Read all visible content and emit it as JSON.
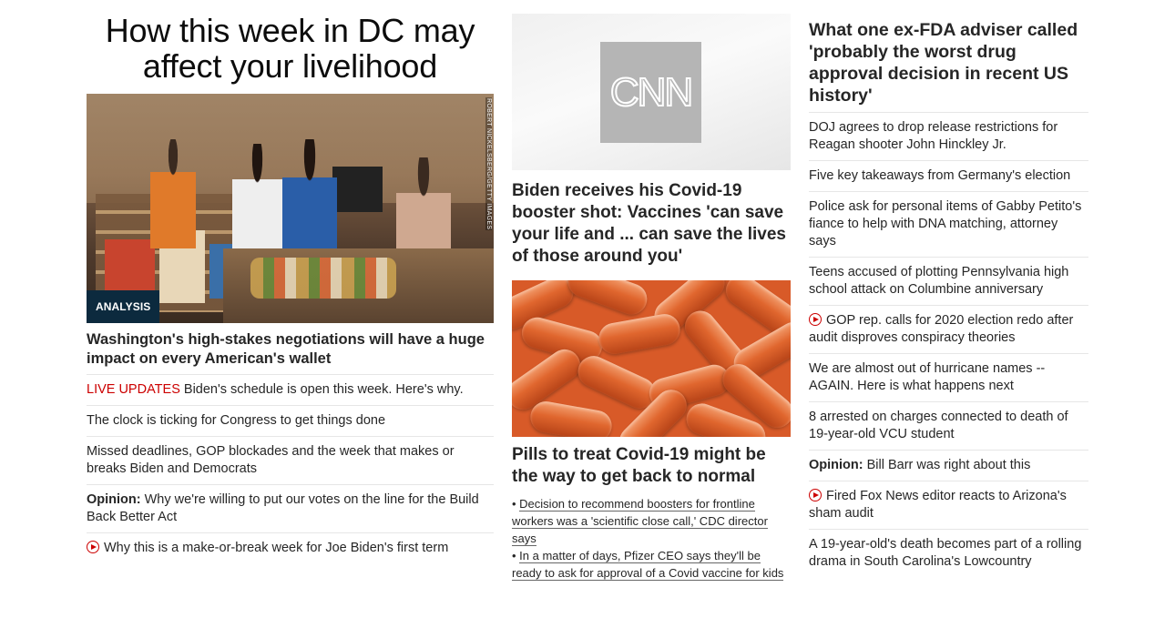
{
  "left": {
    "headline": "How this week in DC may affect your livelihood",
    "hero_credit": "ROBERT NICKELSBERG/GETTY IMAGES",
    "hero_badge": "ANALYSIS",
    "lead_title": "Washington's high-stakes negotiations will have a huge impact on every American's wallet",
    "items": [
      {
        "prefix": "LIVE UPDATES",
        "text": "Biden's schedule is open this week. Here's why."
      },
      {
        "text": "The clock is ticking for Congress to get things done"
      },
      {
        "text": "Missed deadlines, GOP blockades and the week that makes or breaks Biden and Democrats"
      },
      {
        "prefix": "Opinion:",
        "text": "Why we're willing to put our votes on the line for the Build Back Better Act"
      },
      {
        "video": true,
        "text": "Why this is a make-or-break week for Joe Biden's first term"
      }
    ]
  },
  "middle": {
    "logo_text": "CNN",
    "title1": "Biden receives his Covid-19 booster shot: Vaccines 'can save your life and ... can save the lives of those around you'",
    "title2": "Pills to treat Covid-19 might be the way to get back to normal",
    "bullets": [
      "Decision to recommend boosters for frontline workers was a 'scientific close call,' CDC director says",
      "In a matter of days, Pfizer CEO says they'll be ready to ask for approval of a Covid vaccine for kids"
    ]
  },
  "right": {
    "title": "What one ex-FDA adviser called 'probably the worst drug approval decision in recent US history'",
    "items": [
      {
        "text": "DOJ agrees to drop release restrictions for Reagan shooter John Hinckley Jr."
      },
      {
        "text": "Five key takeaways from Germany's election"
      },
      {
        "text": "Police ask for personal items of Gabby Petito's fiance to help with DNA matching, attorney says"
      },
      {
        "text": "Teens accused of plotting Pennsylvania high school attack on Columbine anniversary"
      },
      {
        "video": true,
        "text": "GOP rep. calls for 2020 election redo after audit disproves conspiracy theories"
      },
      {
        "text": "We are almost out of hurricane names -- AGAIN. Here is what happens next"
      },
      {
        "text": "8 arrested on charges connected to death of 19-year-old VCU student"
      },
      {
        "prefix": "Opinion:",
        "text": "Bill Barr was right about this"
      },
      {
        "video": true,
        "text": "Fired Fox News editor reacts to Arizona's sham audit"
      },
      {
        "text": "A 19-year-old's death becomes part of a rolling drama in South Carolina's Lowcountry"
      }
    ]
  },
  "colors": {
    "live": "#cc0000",
    "badge_bg": "#0c2a3e",
    "divider": "#e6e6e6"
  }
}
